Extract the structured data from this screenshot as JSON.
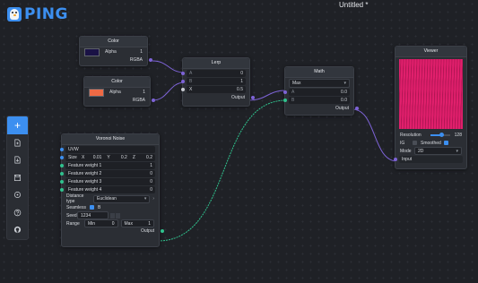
{
  "app": {
    "logo_text": "PING",
    "doc_title": "Untitled *"
  },
  "toolbar": {
    "icons": [
      "plus-icon",
      "new-file-icon",
      "download-icon",
      "save-icon",
      "target-icon",
      "help-icon",
      "github-icon"
    ],
    "plus": "+"
  },
  "color_nodes": [
    {
      "title": "Color",
      "alpha_label": "Alpha",
      "alpha_value": "1",
      "output_label": "RGBA",
      "swatch": "#1a1245"
    },
    {
      "title": "Color",
      "alpha_label": "Alpha",
      "alpha_value": "1",
      "output_label": "RGBA",
      "swatch": "#ee6a45"
    }
  ],
  "lerp": {
    "title": "Lerp",
    "inputs": [
      {
        "label": "A",
        "value": "0"
      },
      {
        "label": "B",
        "value": "1"
      },
      {
        "label": "X",
        "value": "0.5"
      }
    ],
    "output_label": "Output"
  },
  "math": {
    "title": "Math",
    "operation": "Max",
    "inputs": [
      {
        "label": "A",
        "value": "0.0"
      },
      {
        "label": "B",
        "value": "0.0"
      }
    ],
    "output_label": "Output"
  },
  "viewer": {
    "title": "Viewer",
    "resolution_label": "Resolution",
    "resolution_value": "128",
    "resolution_fraction": 0.6,
    "ig_label": "IG",
    "smoothed_label": "Smoothed",
    "mode_label": "Mode",
    "mode_value": "2D",
    "input_label": "Input",
    "preview_colors": [
      "#e11f6c",
      "#a8144e"
    ]
  },
  "voronoi": {
    "title": "Voronoi Noise",
    "uvw_label": "UVW",
    "size_label": "Size",
    "size": [
      {
        "axis": "X",
        "value": "0.01"
      },
      {
        "axis": "Y",
        "value": "0.2"
      },
      {
        "axis": "Z",
        "value": "0.2"
      }
    ],
    "features": [
      {
        "label": "Feature weight 1",
        "value": "1"
      },
      {
        "label": "Feature weight 2",
        "value": "0"
      },
      {
        "label": "Feature weight 3",
        "value": "0"
      },
      {
        "label": "Feature weight 4",
        "value": "0"
      }
    ],
    "distance_label": "Distance type",
    "distance_value": "Euclidean",
    "seamless_label": "Seamless",
    "seamless_value": "B",
    "seed_label": "Seed",
    "seed_value": "1234",
    "range_label": "Range",
    "range_min_label": "Min",
    "range_min_value": "0",
    "range_max_label": "Max",
    "range_max_value": "1",
    "output_label": "Output"
  },
  "colors": {
    "accent": "#3c8ff0",
    "port_purple": "#7d63d6",
    "port_green": "#30c28e",
    "background": "#1f2126"
  }
}
